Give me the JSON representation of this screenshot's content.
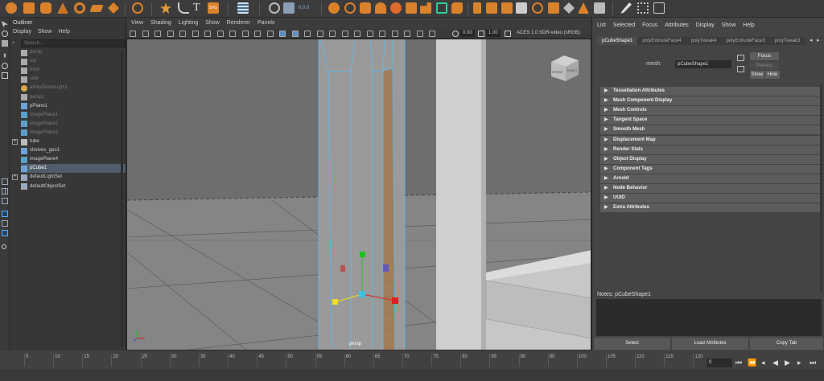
{
  "outliner": {
    "title": "Outliner",
    "menu": [
      "Display",
      "Show",
      "Help"
    ],
    "search_placeholder": "Search...",
    "items": [
      {
        "label": "persp",
        "icon": "camera-icon",
        "dim": true,
        "expand": false
      },
      {
        "label": "top",
        "icon": "camera-icon",
        "dim": true,
        "expand": false
      },
      {
        "label": "front",
        "icon": "camera-icon",
        "dim": true,
        "expand": false
      },
      {
        "label": "side",
        "icon": "camera-icon",
        "dim": true,
        "expand": false
      },
      {
        "label": "aiSkyDomeLight1",
        "icon": "skydome-light-icon",
        "dim": true,
        "expand": false
      },
      {
        "label": "persp1",
        "icon": "camera-icon",
        "dim": true,
        "expand": false
      },
      {
        "label": "pPlane1",
        "icon": "mesh-icon",
        "dim": false,
        "expand": false
      },
      {
        "label": "imagePlane1",
        "icon": "image-plane-icon",
        "dim": true,
        "expand": false
      },
      {
        "label": "imagePlane2",
        "icon": "image-plane-icon",
        "dim": true,
        "expand": false
      },
      {
        "label": "imagePlane3",
        "icon": "image-plane-icon",
        "dim": true,
        "expand": false
      },
      {
        "label": "tube",
        "icon": "group-icon",
        "dim": false,
        "expand": true
      },
      {
        "label": "shelves_geo1",
        "icon": "mesh-icon",
        "dim": false,
        "expand": false
      },
      {
        "label": "imagePlane4",
        "icon": "image-plane-icon",
        "dim": false,
        "expand": false
      },
      {
        "label": "pCube1",
        "icon": "mesh-icon",
        "dim": false,
        "expand": false,
        "selected": true
      },
      {
        "label": "defaultLightSet",
        "icon": "set-icon",
        "dim": false,
        "expand": true
      },
      {
        "label": "defaultObjectSet",
        "icon": "set-icon",
        "dim": false,
        "expand": false
      }
    ]
  },
  "viewport": {
    "menu": [
      "View",
      "Shading",
      "Lighting",
      "Show",
      "Renderer",
      "Panels"
    ],
    "exposure": "0.00",
    "gamma": "1.00",
    "color_space": "ACES 1.0 SDR-video (sRGB)",
    "camera_label": "persp",
    "viewcube_front": "FRONT",
    "viewcube_right": "RIGHT"
  },
  "attribute_editor": {
    "menu": [
      "List",
      "Selected",
      "Focus",
      "Attributes",
      "Display",
      "Show",
      "Help"
    ],
    "tabs": [
      "pCubeShape1",
      "polyExtrudeFace4",
      "polyTweak4",
      "polyExtrudeFace3",
      "polyTweak3"
    ],
    "active_tab": 0,
    "mesh_label": "mesh:",
    "mesh_value": "pCubeShape1",
    "focus_button": "Focus",
    "presets_button": "Presets",
    "show_button": "Show",
    "hide_button": "Hide",
    "sections": [
      "Tessellation Attributes",
      "Mesh Component Display",
      "Mesh Controls",
      "Tangent Space",
      "Smooth Mesh",
      "Displacement Map",
      "Render Stats",
      "Object Display",
      "Component Tags",
      "Arnold",
      "Node Behavior",
      "UUID",
      "Extra Attributes"
    ],
    "notes_label": "Notes:  pCubeShape1",
    "select_button": "Select",
    "load_attributes_button": "Load Attributes",
    "copy_tab_button": "Copy Tab"
  },
  "timeline": {
    "frames": [
      "5",
      "10",
      "15",
      "20",
      "25",
      "30",
      "35",
      "40",
      "45",
      "50",
      "55",
      "60",
      "65",
      "70",
      "75",
      "80",
      "85",
      "90",
      "95",
      "100",
      "105",
      "110",
      "115",
      "120"
    ],
    "current_frame": "0"
  },
  "colors": {
    "selection": "#525d6b",
    "wire_blue": "#5fb8e6",
    "manip_x": "#e02020",
    "manip_y": "#20c020",
    "manip_z": "#4040d0",
    "manip_center": "#3fc0e0",
    "manip_yellow": "#f0e020"
  }
}
